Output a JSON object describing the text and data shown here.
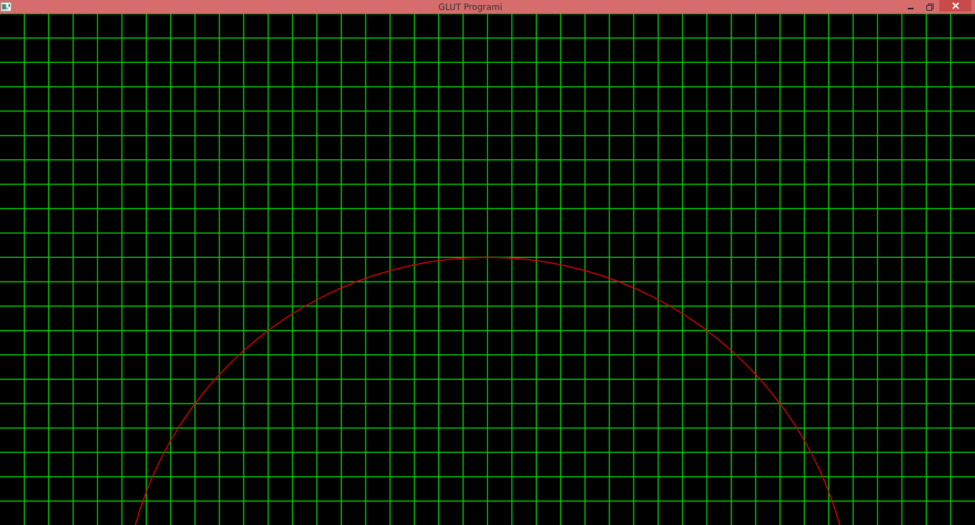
{
  "window": {
    "title": "GLUT Programi"
  }
}
